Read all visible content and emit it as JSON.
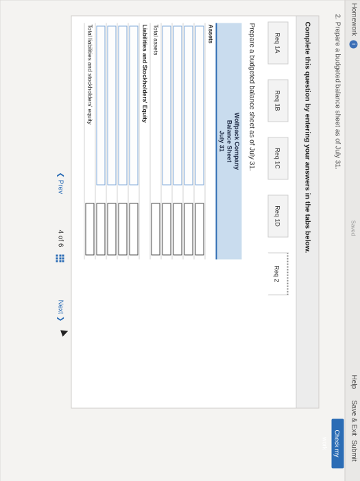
{
  "header": {
    "homework_label": "Homework",
    "homework_badge": "i",
    "saved_label": "Saved",
    "help_label": "Help",
    "save_exit_label": "Save & Exit",
    "submit_label": "Submit"
  },
  "question": {
    "text": "2. Prepare a budgeted balance sheet as of July 31.",
    "check_work_label": "Check my work"
  },
  "instructions": {
    "text": "Complete this question by entering your answers in the tabs below."
  },
  "tabs": [
    {
      "label": "Req 1A"
    },
    {
      "label": "Req 1B"
    },
    {
      "label": "Req 1C"
    },
    {
      "label": "Req 1D"
    },
    {
      "label": "Req 2"
    }
  ],
  "active_tab": "Req 2",
  "prepare_text": "Prepare a budgeted balance sheet as of July 31.",
  "balance_sheet": {
    "company": "Wolfpack Company",
    "title": "Balance Sheet",
    "date": "July 31",
    "assets_label": "Assets",
    "total_assets_label": "Total assets",
    "liabilities_label": "Liabilities and Stockholders' Equity",
    "total_liabilities_label": "Total liabilities and stockholders' equity"
  },
  "navigation": {
    "prev_label": "Prev",
    "page_current": "4",
    "page_of": "of",
    "page_total": "6",
    "next_label": "Next"
  },
  "colors": {
    "accent": "#2b6cb5",
    "sheet_header": "#c9dcee"
  }
}
